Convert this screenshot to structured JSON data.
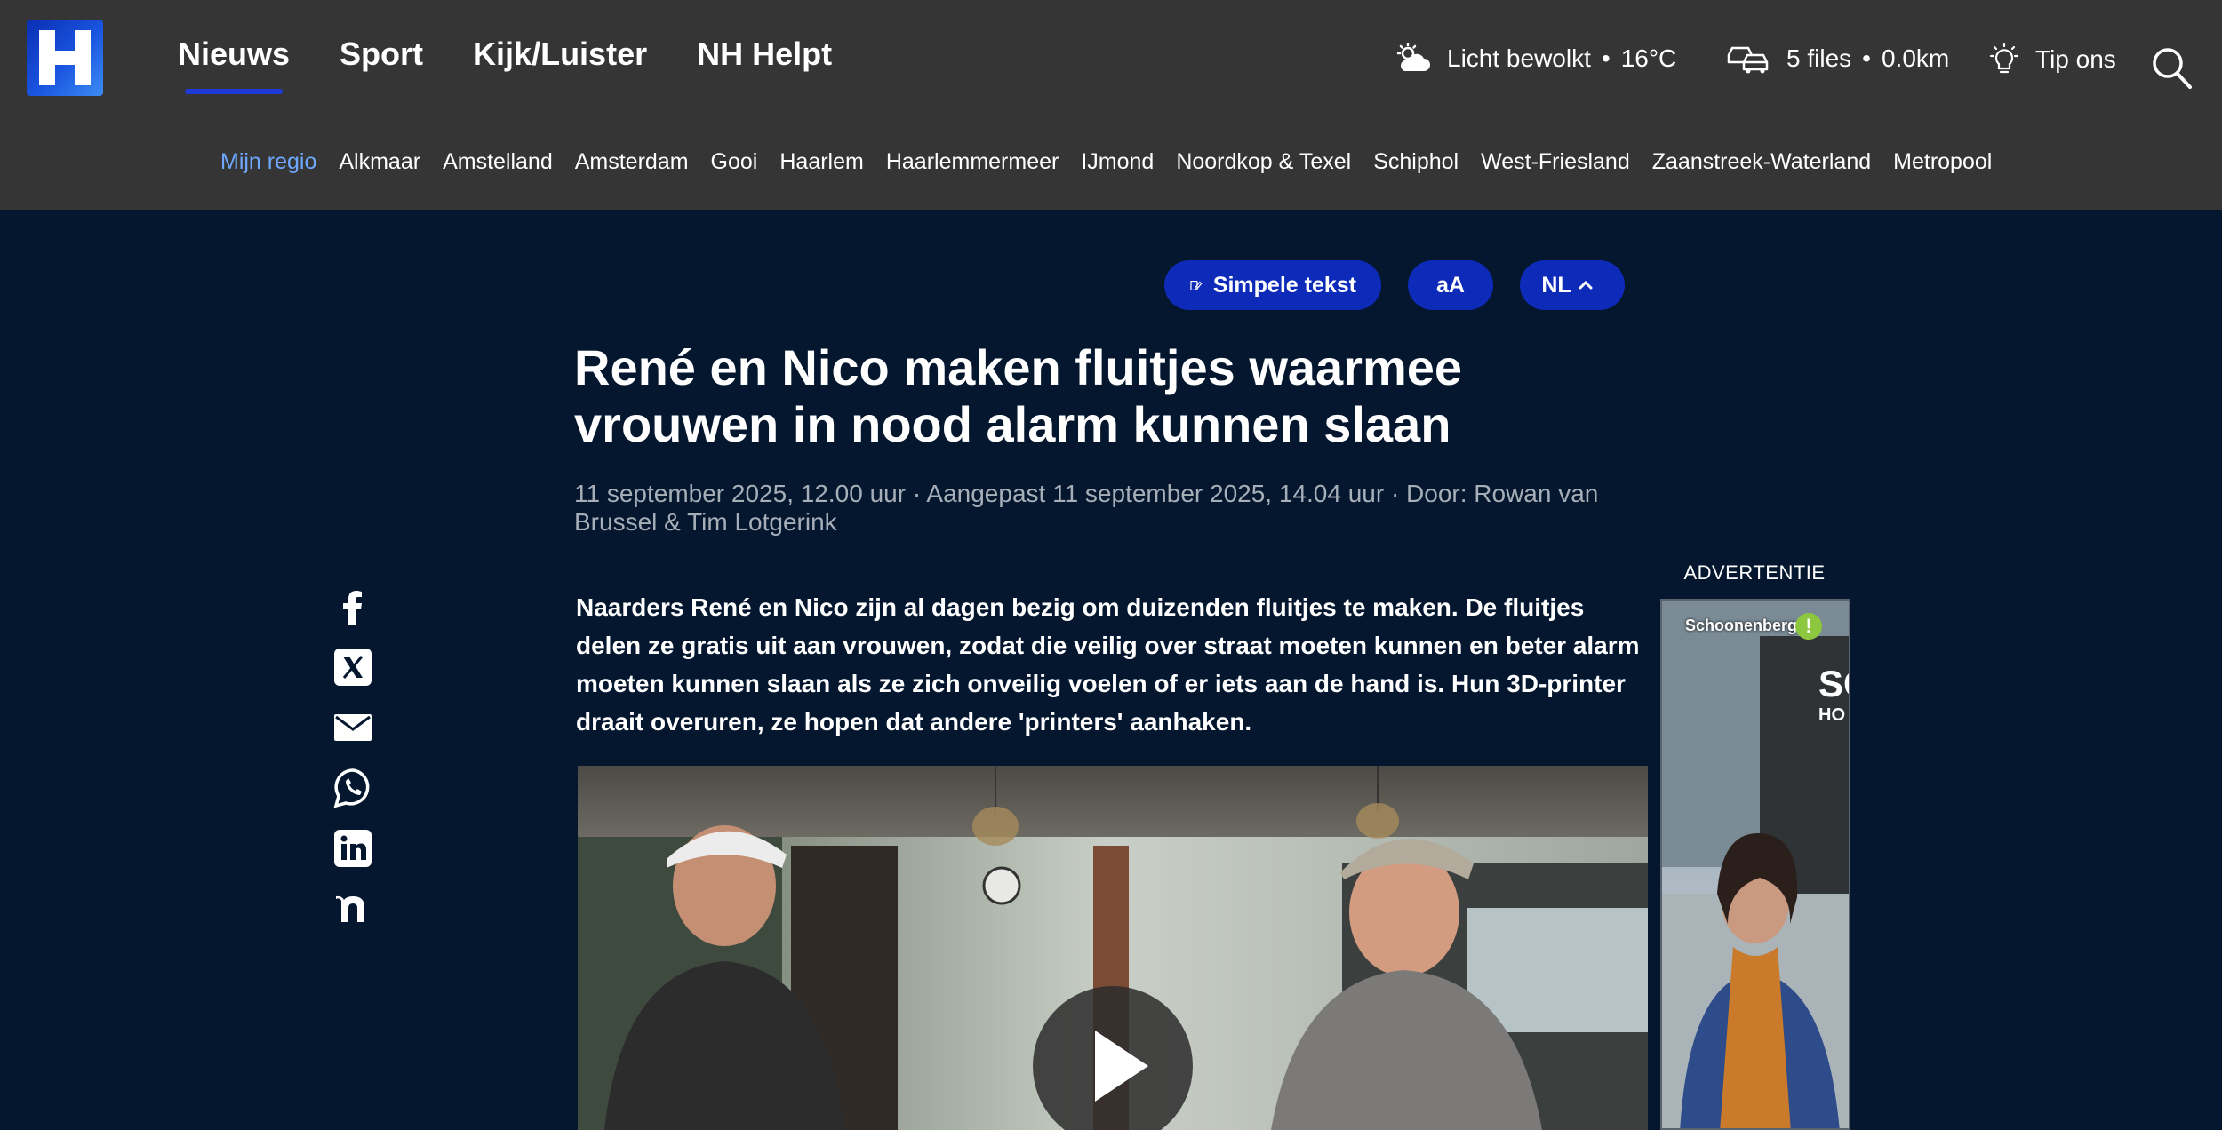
{
  "header": {
    "logo_alt": "NH",
    "nav": [
      {
        "label": "Nieuws",
        "active": true
      },
      {
        "label": "Sport",
        "active": false
      },
      {
        "label": "Kijk/Luister",
        "active": false
      },
      {
        "label": "NH Helpt",
        "active": false
      }
    ],
    "weather": {
      "icon": "cloud-sun-icon",
      "text": "Licht bewolkt",
      "temp": "16°C"
    },
    "traffic": {
      "icon": "cars-icon",
      "files": "5 files",
      "km": "0.0km"
    },
    "tip": {
      "icon": "lightbulb-icon",
      "label": "Tip ons"
    },
    "search_icon": "search-icon"
  },
  "regions": [
    {
      "label": "Mijn regio",
      "active": true
    },
    {
      "label": "Alkmaar"
    },
    {
      "label": "Amstelland"
    },
    {
      "label": "Amsterdam"
    },
    {
      "label": "Gooi"
    },
    {
      "label": "Haarlem"
    },
    {
      "label": "Haarlemmermeer"
    },
    {
      "label": "IJmond"
    },
    {
      "label": "Noordkop & Texel"
    },
    {
      "label": "Schiphol"
    },
    {
      "label": "West-Friesland"
    },
    {
      "label": "Zaanstreek-Waterland"
    },
    {
      "label": "Metropool"
    }
  ],
  "toolbar": {
    "simple_text": "Simpele tekst",
    "font_size": "aA",
    "language": "NL"
  },
  "article": {
    "title": "René en Nico maken fluitjes waarmee vrouwen in nood alarm kunnen slaan",
    "meta": "11 september 2025, 12.00 uur · Aangepast 11 september 2025, 14.04 uur · Door: Rowan van Brussel & Tim Lotgerink",
    "lead": "Naarders René en Nico zijn al dagen bezig om duizenden fluitjes te maken. De fluitjes delen ze gratis uit aan vrouwen, zodat die veilig over straat moeten kunnen en beter alarm moeten kunnen slaan als ze zich onveilig voelen of er iets aan de hand is. Hun 3D-printer draait overuren, ze hopen dat andere 'printers' aanhaken."
  },
  "social": [
    "facebook-icon",
    "x-icon",
    "mail-icon",
    "whatsapp-icon",
    "linkedin-icon",
    "nu-icon"
  ],
  "advert": {
    "label": "ADVERTENTIE",
    "brand": "Schoonenberg",
    "sign_text": "SC",
    "sign_text2": "HO"
  },
  "colors": {
    "header_bg": "#353535",
    "page_bg": "#04172f",
    "accent": "#0d2bb8",
    "region_active": "#6ea8ff"
  }
}
